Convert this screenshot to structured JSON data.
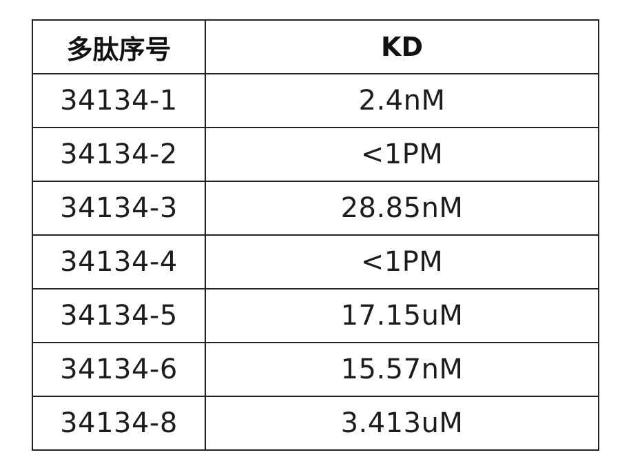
{
  "table": {
    "headers": [
      "多肽序号",
      "KD"
    ],
    "rows": [
      [
        "34134-1",
        "2.4nM"
      ],
      [
        "34134-2",
        "<1PM"
      ],
      [
        "34134-3",
        "28.85nM"
      ],
      [
        "34134-4",
        "<1PM"
      ],
      [
        "34134-5",
        "17.15uM"
      ],
      [
        "34134-6",
        "15.57nM"
      ],
      [
        "34134-8",
        "3.413uM"
      ]
    ]
  }
}
